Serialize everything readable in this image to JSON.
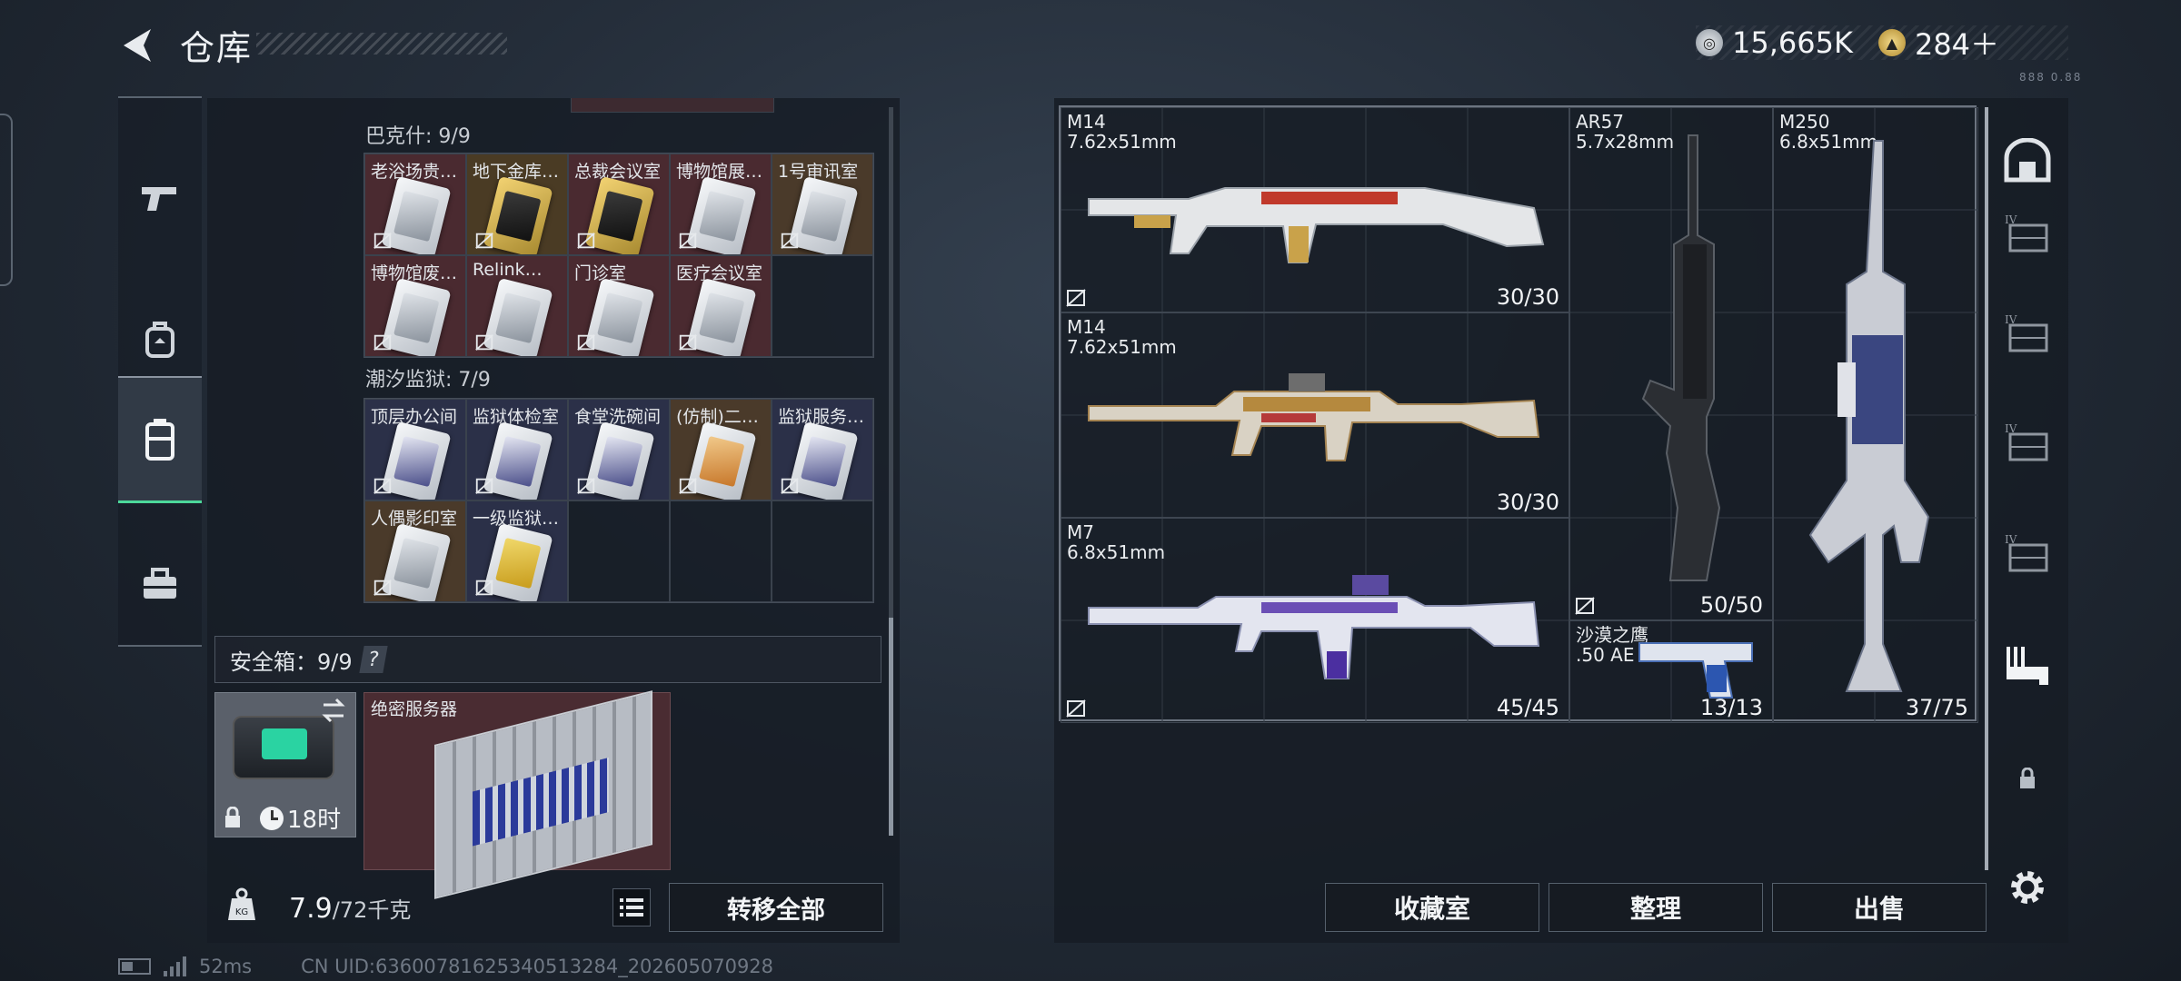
{
  "header": {
    "title": "仓库",
    "currency": [
      {
        "icon": "silver-coin-icon",
        "value": "15,665K"
      },
      {
        "icon": "gold-triangle-coin-icon",
        "value": "284＋"
      }
    ],
    "version": "888 0.88"
  },
  "left_nav": [
    {
      "icon": "pistol-icon"
    },
    {
      "icon": "backpack-icon"
    },
    {
      "icon": "storage-case-icon",
      "active": true
    },
    {
      "icon": "toolbox-icon"
    }
  ],
  "storage": {
    "sections": [
      {
        "title": "巴克什: 9/9",
        "items": [
          {
            "name": "老浴场贵…",
            "bg": "red",
            "card": "silver"
          },
          {
            "name": "地下金库…",
            "bg": "gold",
            "card": "gold"
          },
          {
            "name": "总裁会议室",
            "bg": "red",
            "card": "gold"
          },
          {
            "name": "博物馆展…",
            "bg": "red",
            "card": "silver"
          },
          {
            "name": "1号审讯室",
            "bg": "brown",
            "card": "silver"
          },
          {
            "name": "博物馆废…",
            "bg": "red",
            "card": "silver"
          },
          {
            "name": "Relink…",
            "bg": "red",
            "card": "silver"
          },
          {
            "name": "门诊室",
            "bg": "red",
            "card": "silver"
          },
          {
            "name": "医疗会议室",
            "bg": "red",
            "card": "silver"
          }
        ]
      },
      {
        "title": "潮汐监狱: 7/9",
        "items": [
          {
            "name": "顶层办公间",
            "bg": "navy",
            "card": "blue"
          },
          {
            "name": "监狱体检室",
            "bg": "navy",
            "card": "blue"
          },
          {
            "name": "食堂洗碗间",
            "bg": "navy",
            "card": "blue"
          },
          {
            "name": "(仿制)二…",
            "bg": "brown",
            "card": "orange"
          },
          {
            "name": "监狱服务…",
            "bg": "navy",
            "card": "blue"
          },
          {
            "name": "人偶影印室",
            "bg": "brown",
            "card": "silver"
          },
          {
            "name": "一级监狱…",
            "bg": "navy",
            "card": "yellow"
          }
        ]
      }
    ]
  },
  "safebox": {
    "label": "安全箱：9/9",
    "help": "?",
    "timer": "18时",
    "item_name": "绝密服务器"
  },
  "weight": {
    "current": "7.9",
    "max": "/72千克"
  },
  "transfer_label": "转移全部",
  "status": {
    "ping": "52ms",
    "uid": "CN UID:636007816253405132​84_202605070928"
  },
  "weapons": [
    {
      "name": "M14",
      "caliber": "7.62x51mm",
      "ammo": "30/30",
      "palette": "#e8e9ea"
    },
    {
      "name": "M14",
      "caliber": "7.62x51mm",
      "ammo": "30/30",
      "palette": "#c9a46a"
    },
    {
      "name": "M7",
      "caliber": "6.8x51mm",
      "ammo": "45/45",
      "palette": "#6b4fb5"
    },
    {
      "name": "AR57",
      "caliber": "5.7x28mm",
      "ammo": "50/50",
      "palette": "#2a2d31"
    },
    {
      "name": "沙漠之鹰",
      "caliber": ".50 AE",
      "ammo": "13/13",
      "palette": "#5a8bd6"
    },
    {
      "name": "M250",
      "caliber": "6.8x51mm",
      "ammo": "37/75",
      "palette": "#9aa3b5"
    }
  ],
  "right_nav": [
    {
      "icon": "locker-icon"
    },
    {
      "icon": "vest-iv-icon",
      "label": "IV"
    },
    {
      "icon": "vest-iv-icon",
      "label": "IV"
    },
    {
      "icon": "vest-iv-icon",
      "label": "IV"
    },
    {
      "icon": "vest-iv-icon",
      "label": "IV"
    },
    {
      "icon": "weapon-rack-icon"
    },
    {
      "icon": "lock-icon"
    },
    {
      "icon": "settings-icon"
    }
  ],
  "actions": {
    "collection": "收藏室",
    "sort": "整理",
    "sell": "出售"
  }
}
